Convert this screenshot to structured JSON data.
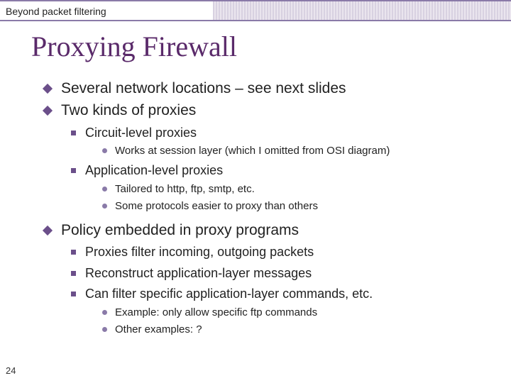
{
  "page_number": "24",
  "section_label": "Beyond packet filtering",
  "title": "Proxying Firewall",
  "bullets": [
    {
      "level": 1,
      "text": "Several network locations – see next slides"
    },
    {
      "level": 1,
      "text": "Two kinds of proxies"
    },
    {
      "level": 2,
      "text": "Circuit-level proxies"
    },
    {
      "level": 3,
      "text": "Works at session layer (which I omitted from OSI diagram)"
    },
    {
      "level": 2,
      "text": "Application-level proxies"
    },
    {
      "level": 3,
      "text": "Tailored to http, ftp, smtp, etc."
    },
    {
      "level": 3,
      "text": "Some protocols easier to proxy than others"
    },
    {
      "level": 1,
      "text": "Policy embedded in proxy programs"
    },
    {
      "level": 2,
      "text": "Proxies filter incoming, outgoing packets"
    },
    {
      "level": 2,
      "text": "Reconstruct application-layer messages"
    },
    {
      "level": 2,
      "text": "Can filter specific application-layer commands, etc."
    },
    {
      "level": 3,
      "text": "Example: only allow specific ftp commands"
    },
    {
      "level": 3,
      "text": "Other examples: ?"
    }
  ]
}
